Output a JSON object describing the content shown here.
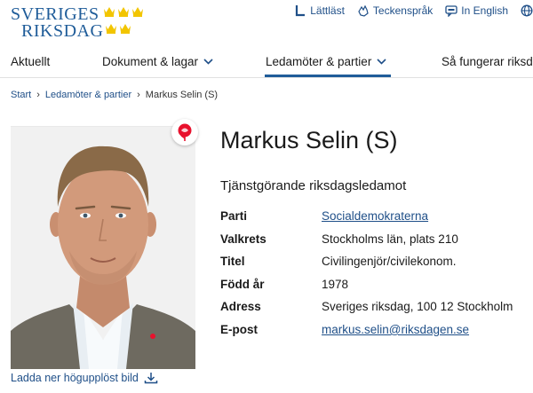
{
  "header": {
    "logo_line1": "SVERIGES",
    "logo_line2": "RIKSDAG",
    "tools": [
      {
        "label": "Lättläst",
        "icon": "easy-read-icon"
      },
      {
        "label": "Teckenspråk",
        "icon": "sign-language-icon"
      },
      {
        "label": "In English",
        "icon": "english-language-icon"
      },
      {
        "label": "",
        "icon": "globe-icon"
      }
    ]
  },
  "nav": {
    "items": [
      {
        "label": "Aktuellt"
      },
      {
        "label": "Dokument & lagar"
      },
      {
        "label": "Ledamöter & partier"
      },
      {
        "label": "Så fungerar riksda"
      }
    ],
    "active": "Ledamöter & partier"
  },
  "breadcrumb": {
    "items": [
      "Start",
      "Ledamöter & partier",
      "Markus Selin (S)"
    ],
    "separator": "›"
  },
  "profile": {
    "name": "Markus Selin (S)",
    "role": "Tjänstgörande riksdagsledamot",
    "facts": [
      {
        "label": "Parti",
        "value": "Socialdemokraterna",
        "link": true
      },
      {
        "label": "Valkrets",
        "value": "Stockholms län, plats 210",
        "link": false
      },
      {
        "label": "Titel",
        "value": "Civilingenjör/civilekonom.",
        "link": false
      },
      {
        "label": "Född år",
        "value": "1978",
        "link": false
      },
      {
        "label": "Adress",
        "value": "Sveriges riksdag, 100 12 Stockholm",
        "link": false
      },
      {
        "label": "E-post",
        "value": "markus.selin@riksdagen.se",
        "link": true
      }
    ],
    "download_label": "Ladda ner högupplöst bild",
    "party_badge_icon": "social-democrats-rose-icon"
  },
  "colors": {
    "brand_blue": "#1f5c99",
    "link_blue": "#1f4f88",
    "crown_gold": "#f2c500",
    "party_red": "#e8112d"
  }
}
